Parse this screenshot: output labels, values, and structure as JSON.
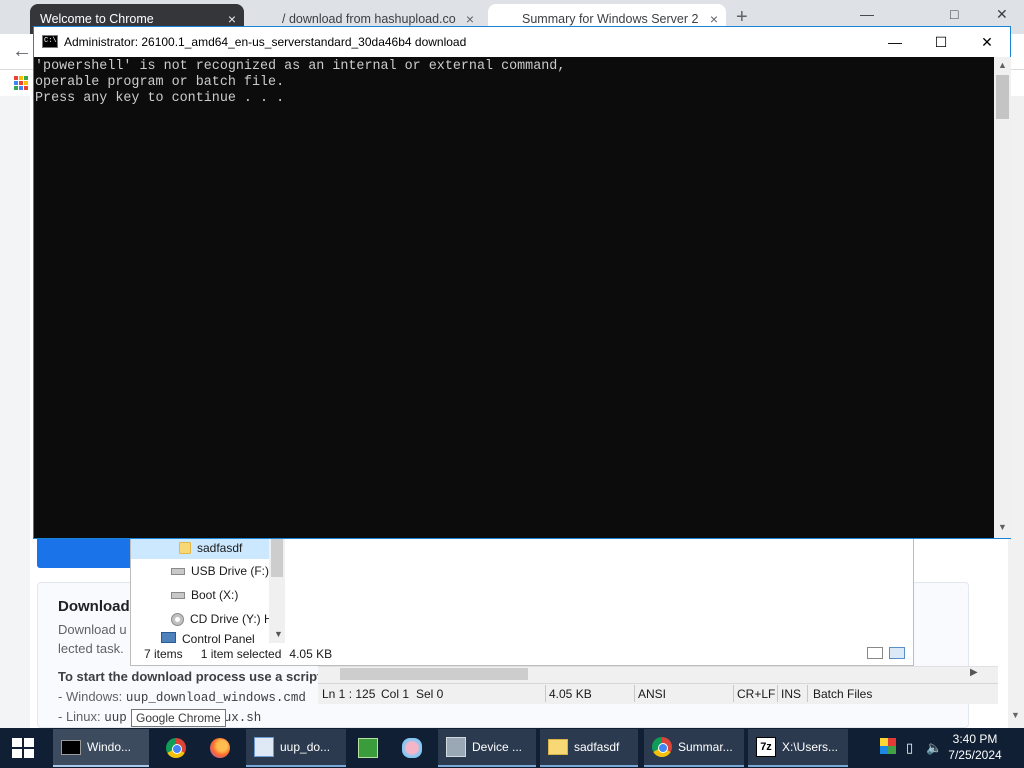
{
  "chrome": {
    "tabs": [
      {
        "label": "Welcome to Chrome",
        "close": "×"
      },
      {
        "label": "/ download from hashupload.co",
        "close": "×"
      },
      {
        "label": "Summary for Windows Server 2",
        "close": "×"
      }
    ],
    "new_tab": "+",
    "window_controls": {
      "minimize": "—",
      "maximize": "□",
      "close": "✕"
    },
    "back": "←"
  },
  "page": {
    "card_title": "Download",
    "card_desc": "Download u lected task.",
    "card_strong": "To start the download process use a script",
    "lines": [
      {
        "prefix": "- Windows: ",
        "code": "uup_download_windows.cmd"
      },
      {
        "prefix": "- Linux: ",
        "code": "uup",
        "code_end": "ux.sh"
      }
    ]
  },
  "tooltip": "Google Chrome",
  "explorer": {
    "nav_items": [
      {
        "label": "sadfasdf",
        "icon": "folder-icon"
      },
      {
        "label": "USB Drive (F:)",
        "icon": "usb-drive-icon"
      },
      {
        "label": "Boot (X:)",
        "icon": "drive-icon"
      },
      {
        "label": "CD Drive (Y:) H",
        "icon": "cd-drive-icon"
      },
      {
        "label": "Control Panel",
        "icon": "control-panel-icon"
      }
    ],
    "status": {
      "items": "7 items",
      "selected": "1 item selected",
      "size": "4.05 KB"
    }
  },
  "notepad_status": {
    "position": "Ln 1 : 125",
    "col": "Col 1",
    "sel": "Sel 0",
    "size": "4.05 KB",
    "encoding": "ANSI",
    "line_ending": "CR+LF",
    "mode": "INS",
    "language": "Batch Files"
  },
  "console": {
    "title": "Administrator:  26100.1_amd64_en-us_serverstandard_30da46b4 download",
    "icon_text": "C:\\",
    "lines": [
      "'powershell' is not recognized as an internal or external command,",
      "operable program or batch file.",
      "Press any key to continue . . ."
    ],
    "minimize": "—",
    "maximize": "☐",
    "close": "✕"
  },
  "taskbar": {
    "items": [
      {
        "label": "Windo...",
        "icon": "cmd-icon",
        "state": "active"
      },
      {
        "label": "",
        "icon": "chrome-icon",
        "state": ""
      },
      {
        "label": "",
        "icon": "firefox-icon",
        "state": ""
      },
      {
        "label": "uup_do...",
        "icon": "notepad-icon",
        "state": "open"
      },
      {
        "label": "",
        "icon": "green-app-icon",
        "state": ""
      },
      {
        "label": "",
        "icon": "paint-icon",
        "state": ""
      },
      {
        "label": "Device ...",
        "icon": "device-manager-icon",
        "state": "open"
      },
      {
        "label": "sadfasdf",
        "icon": "folder-icon",
        "state": "open"
      },
      {
        "label": "Summar...",
        "icon": "chrome-icon",
        "state": "open"
      },
      {
        "label": "X:\\Users...",
        "icon": "7zip-icon",
        "state": "open"
      }
    ],
    "icon_7z": "7z",
    "tray": {
      "arrow": "▯",
      "speaker": "🔈"
    },
    "clock": {
      "time": "3:40 PM",
      "date": "7/25/2024"
    }
  },
  "colors": {
    "console_bg": "#0c0c0c",
    "console_text": "#cccccc",
    "accent_border": "#1883d7",
    "taskbar_bg": "#101f33",
    "link_blue": "#1a73e8"
  }
}
